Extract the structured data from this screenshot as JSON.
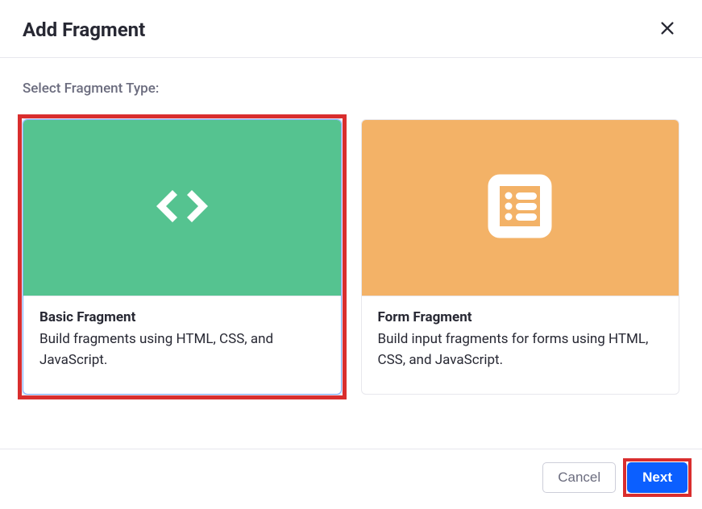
{
  "header": {
    "title": "Add Fragment"
  },
  "body": {
    "sectionLabel": "Select Fragment Type:",
    "cards": [
      {
        "title": "Basic Fragment",
        "description": "Build fragments using HTML, CSS, and JavaScript."
      },
      {
        "title": "Form Fragment",
        "description": "Build input fragments for forms using HTML, CSS, and JavaScript."
      }
    ]
  },
  "footer": {
    "cancel": "Cancel",
    "next": "Next"
  }
}
